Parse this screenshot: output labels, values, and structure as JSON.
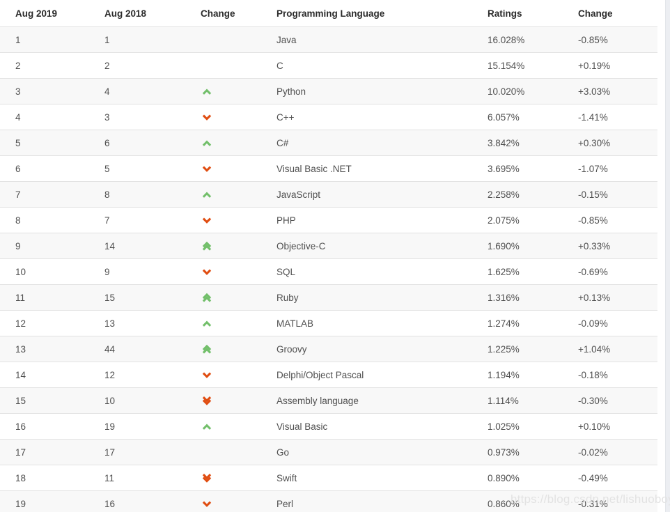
{
  "table": {
    "columns": [
      {
        "key": "rank_new",
        "label": "Aug 2019"
      },
      {
        "key": "rank_old",
        "label": "Aug 2018"
      },
      {
        "key": "change",
        "label": "Change"
      },
      {
        "key": "language",
        "label": "Programming Language"
      },
      {
        "key": "ratings",
        "label": "Ratings"
      },
      {
        "key": "delta",
        "label": "Change"
      }
    ],
    "rows": [
      {
        "rank_new": "1",
        "rank_old": "1",
        "change": "none",
        "language": "Java",
        "ratings": "16.028%",
        "delta": "-0.85%"
      },
      {
        "rank_new": "2",
        "rank_old": "2",
        "change": "none",
        "language": "C",
        "ratings": "15.154%",
        "delta": "+0.19%"
      },
      {
        "rank_new": "3",
        "rank_old": "4",
        "change": "up",
        "language": "Python",
        "ratings": "10.020%",
        "delta": "+3.03%"
      },
      {
        "rank_new": "4",
        "rank_old": "3",
        "change": "down",
        "language": "C++",
        "ratings": "6.057%",
        "delta": "-1.41%"
      },
      {
        "rank_new": "5",
        "rank_old": "6",
        "change": "up",
        "language": "C#",
        "ratings": "3.842%",
        "delta": "+0.30%"
      },
      {
        "rank_new": "6",
        "rank_old": "5",
        "change": "down",
        "language": "Visual Basic .NET",
        "ratings": "3.695%",
        "delta": "-1.07%"
      },
      {
        "rank_new": "7",
        "rank_old": "8",
        "change": "up",
        "language": "JavaScript",
        "ratings": "2.258%",
        "delta": "-0.15%"
      },
      {
        "rank_new": "8",
        "rank_old": "7",
        "change": "down",
        "language": "PHP",
        "ratings": "2.075%",
        "delta": "-0.85%"
      },
      {
        "rank_new": "9",
        "rank_old": "14",
        "change": "up-double",
        "language": "Objective-C",
        "ratings": "1.690%",
        "delta": "+0.33%"
      },
      {
        "rank_new": "10",
        "rank_old": "9",
        "change": "down",
        "language": "SQL",
        "ratings": "1.625%",
        "delta": "-0.69%"
      },
      {
        "rank_new": "11",
        "rank_old": "15",
        "change": "up-double",
        "language": "Ruby",
        "ratings": "1.316%",
        "delta": "+0.13%"
      },
      {
        "rank_new": "12",
        "rank_old": "13",
        "change": "up",
        "language": "MATLAB",
        "ratings": "1.274%",
        "delta": "-0.09%"
      },
      {
        "rank_new": "13",
        "rank_old": "44",
        "change": "up-double",
        "language": "Groovy",
        "ratings": "1.225%",
        "delta": "+1.04%"
      },
      {
        "rank_new": "14",
        "rank_old": "12",
        "change": "down",
        "language": "Delphi/Object Pascal",
        "ratings": "1.194%",
        "delta": "-0.18%"
      },
      {
        "rank_new": "15",
        "rank_old": "10",
        "change": "down-double",
        "language": "Assembly language",
        "ratings": "1.114%",
        "delta": "-0.30%"
      },
      {
        "rank_new": "16",
        "rank_old": "19",
        "change": "up",
        "language": "Visual Basic",
        "ratings": "1.025%",
        "delta": "+0.10%"
      },
      {
        "rank_new": "17",
        "rank_old": "17",
        "change": "none",
        "language": "Go",
        "ratings": "0.973%",
        "delta": "-0.02%"
      },
      {
        "rank_new": "18",
        "rank_old": "11",
        "change": "down-double",
        "language": "Swift",
        "ratings": "0.890%",
        "delta": "-0.49%"
      },
      {
        "rank_new": "19",
        "rank_old": "16",
        "change": "down",
        "language": "Perl",
        "ratings": "0.860%",
        "delta": "-0.31%"
      }
    ]
  },
  "icons": {
    "up": "chevron-up-icon",
    "down": "chevron-down-icon",
    "up-double": "chevron-double-up-icon",
    "down-double": "chevron-double-down-icon",
    "none": "no-change-icon"
  },
  "colors": {
    "up": "#72bf6a",
    "down": "#e04d11",
    "row_odd": "#f8f8f8",
    "row_even": "#ffffff",
    "border": "#e2e2e2",
    "header_text": "#2b2b2b",
    "cell_text": "#4f4f4f",
    "watermark": "#e3e3e3"
  },
  "watermark": {
    "text": "https://blog.csdn.net/lishuoboy"
  }
}
